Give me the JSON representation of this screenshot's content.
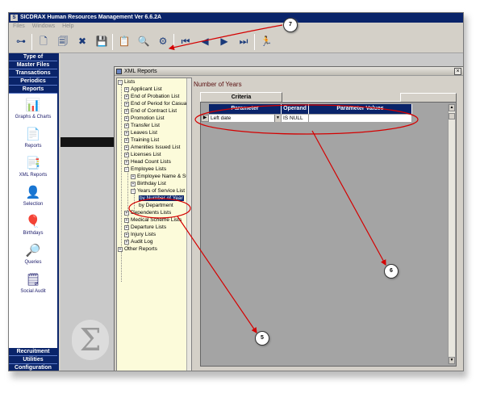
{
  "window": {
    "title": "SICDRAX Human Resources Management Ver 6.6.2A",
    "icon": "app-s-icon",
    "menu": [
      "Files",
      "Windows",
      "Help"
    ]
  },
  "toolbar": {
    "icons": [
      "tree-icon",
      "document-icon",
      "copy-icon",
      "delete-icon",
      "save-icon",
      "report-icon",
      "preview-icon",
      "link-icon",
      "first-icon",
      "prev-icon",
      "next-icon",
      "last-icon",
      "run-icon"
    ],
    "glyphs": [
      "⊶",
      "🗋",
      "🗐",
      "✖",
      "💾",
      "📋",
      "🔍",
      "⚙",
      "⏮",
      "◀",
      "▶",
      "⏭",
      "🏃"
    ]
  },
  "sidebar": {
    "top_items": [
      "Type of",
      "Master Files",
      "Transactions",
      "Periodics",
      "Reports"
    ],
    "icon_items": [
      {
        "label": "Graphs & Charts",
        "icon": "chart-icon",
        "glyph": "📊"
      },
      {
        "label": "Reports",
        "icon": "report-icon",
        "glyph": "📄"
      },
      {
        "label": "XML Reports",
        "icon": "xml-icon",
        "glyph": "📑"
      },
      {
        "label": "Selection",
        "icon": "selection-icon",
        "glyph": "👤"
      },
      {
        "label": "Birthdays",
        "icon": "balloon-icon",
        "glyph": "🎈"
      },
      {
        "label": "Queries",
        "icon": "query-icon",
        "glyph": "🔎"
      },
      {
        "label": "Social Audit",
        "icon": "audit-icon",
        "glyph": "🗒"
      }
    ],
    "bottom_items": [
      "Recruitment",
      "Utilities",
      "Configuration"
    ]
  },
  "xml_window": {
    "title": "XML Reports",
    "close": "×",
    "tree": {
      "root": "Lists",
      "items": [
        "Applicant List",
        "End of Probation List",
        "End of Period for Casual I",
        "End of Contract List",
        "Promotion List",
        "Transfer List",
        "Leaves List",
        "Training List",
        "Amenities Issued List",
        "Licenses List",
        "Head Count Lists",
        "Employee Lists"
      ],
      "employee_children": [
        "Employee Name & Sur",
        "Birthday List",
        "Years of Service List"
      ],
      "service_children": [
        "by Number of Year",
        "by Department"
      ],
      "after": [
        "Dependents Lists",
        "Medical Scheme Lists",
        "Departure Lists",
        "Injury Lists",
        "Audit Log"
      ],
      "other": "Other Reports"
    },
    "report_header": "Number of Years",
    "tab": "Criteria",
    "grid": {
      "headers": [
        "Parameter",
        "Operand",
        "Parameter Values"
      ],
      "row": {
        "indicator": "▶",
        "parameter": "Left date",
        "operand": "IS NULL",
        "value": ""
      }
    }
  },
  "annotations": [
    "7",
    "6",
    "5"
  ],
  "colors": {
    "nav_blue": "#0a246a",
    "tree_bg": "#fcfbda",
    "annotation_red": "#d40000"
  }
}
